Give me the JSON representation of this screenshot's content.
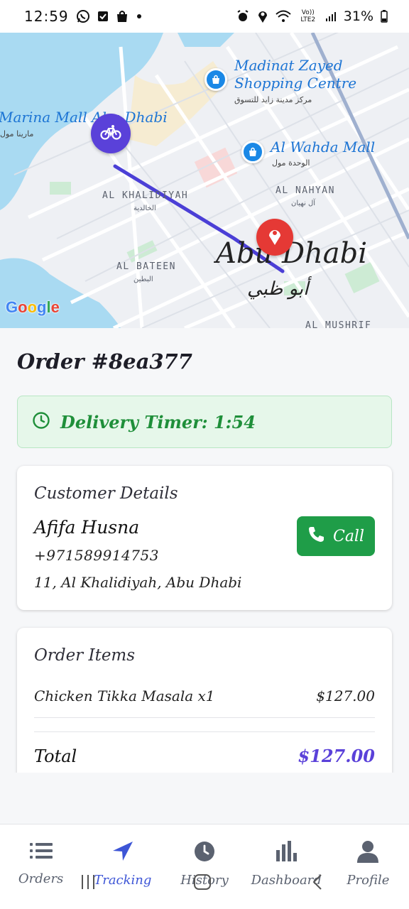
{
  "status_bar": {
    "time": "12:59",
    "left_icons": [
      "whatsapp-icon",
      "checkbox-icon",
      "shopping-bag-icon",
      "dot-icon"
    ],
    "right_icons": [
      "alarm-icon",
      "location-icon",
      "wifi-icon",
      "volte-icon",
      "signal-icon"
    ],
    "network": "Vo)) LTE2",
    "battery": "31%"
  },
  "map": {
    "pois": [
      {
        "name_line1": "Madinat Zayed",
        "name_line2": "Shopping Centre",
        "arabic": "مركز مدينة زايد للتسوق"
      },
      {
        "name_line1": "Al Wahda Mall",
        "arabic": "الوحدة مول"
      },
      {
        "name_line1": "Marina Mall Abu Dhabi",
        "arabic": "مارينا مول"
      }
    ],
    "areas": [
      {
        "name": "AL KHALIDIYAH",
        "arabic": "الخالدية"
      },
      {
        "name": "AL NAHYAN",
        "arabic": "آل نهيان"
      },
      {
        "name": "AL BATEEN",
        "arabic": "البطين"
      },
      {
        "name": "AL MUSHRIF",
        "arabic": ""
      }
    ],
    "city": {
      "name": "Abu Dhabi",
      "arabic": "أبو ظبي"
    },
    "attribution": "Google",
    "rider_icon": "bicycle-icon",
    "destination_icon": "location-pin-icon",
    "colors": {
      "water": "#a9daf2",
      "land": "#eef0f4",
      "park": "#cdebd4",
      "route": "#4b3fd6",
      "rider": "#5a41d9",
      "destination": "#e53935",
      "poi": "#1a88e6"
    }
  },
  "order": {
    "title": "Order #8ea377",
    "timer_label": "Delivery Timer: 1:54"
  },
  "customer": {
    "section_title": "Customer Details",
    "name": "Afifa Husna",
    "phone": "+971589914753",
    "address": "11, Al Khalidiyah, Abu Dhabi",
    "call_label": "Call"
  },
  "items": {
    "section_title": "Order Items",
    "list": [
      {
        "name": "Chicken Tikka Masala x1",
        "price": "$127.00"
      }
    ],
    "total_label": "Total",
    "total_value": "$127.00"
  },
  "nav": [
    {
      "label": "Orders",
      "icon": "list-icon",
      "active": false
    },
    {
      "label": "Tracking",
      "icon": "navigation-arrow-icon",
      "active": true
    },
    {
      "label": "History",
      "icon": "clock-icon",
      "active": false
    },
    {
      "label": "Dashboard",
      "icon": "bar-chart-icon",
      "active": false
    },
    {
      "label": "Profile",
      "icon": "user-icon",
      "active": false
    }
  ],
  "theme": {
    "accent": "#5a41d9",
    "success": "#1f9d48",
    "active_nav": "#3d55d6"
  }
}
